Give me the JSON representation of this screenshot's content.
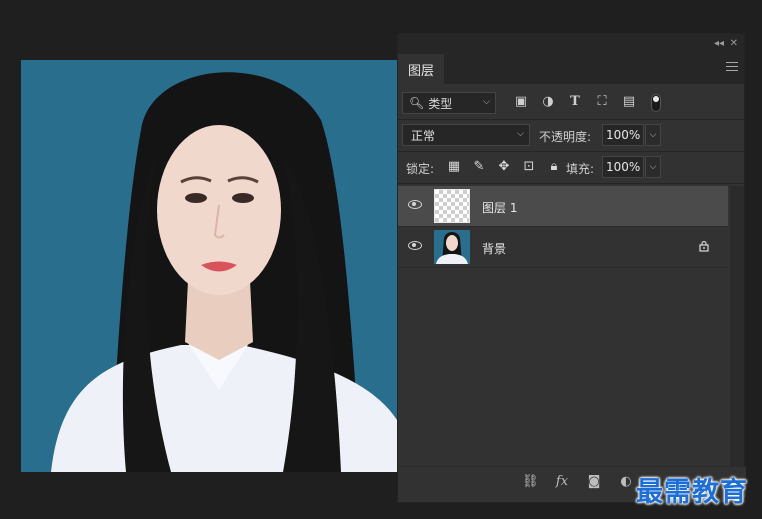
{
  "panel": {
    "tab_label": "图层",
    "filter": {
      "selected": "类型"
    },
    "blend_mode": "正常",
    "opacity": {
      "label": "不透明度:",
      "value": "100%"
    },
    "lock": {
      "label": "锁定:"
    },
    "fill": {
      "label": "填充:",
      "value": "100%"
    },
    "layers": [
      {
        "name": "图层 1",
        "selected": true,
        "visible": true,
        "thumbnail": "transparent"
      },
      {
        "name": "背景",
        "selected": false,
        "visible": true,
        "locked": true,
        "thumbnail": "photo"
      }
    ]
  },
  "icons": {
    "filter": [
      "image-filter-icon",
      "adjustment-filter-icon",
      "type-filter-icon",
      "shape-filter-icon",
      "smart-object-filter-icon"
    ],
    "lock": [
      "lock-transparent-pixels-icon",
      "lock-image-pixels-icon",
      "lock-position-icon",
      "lock-artboard-icon",
      "lock-all-icon"
    ],
    "bottom": [
      "link-layers-icon",
      "fx-icon",
      "add-mask-icon",
      "adjustment-layer-icon"
    ]
  },
  "colors": {
    "canvas_background": "#2a6e8e",
    "panel_background": "#323232",
    "selected_layer": "#4b4b4b",
    "watermark": "#1d6fd6"
  },
  "watermark": "最需教育"
}
